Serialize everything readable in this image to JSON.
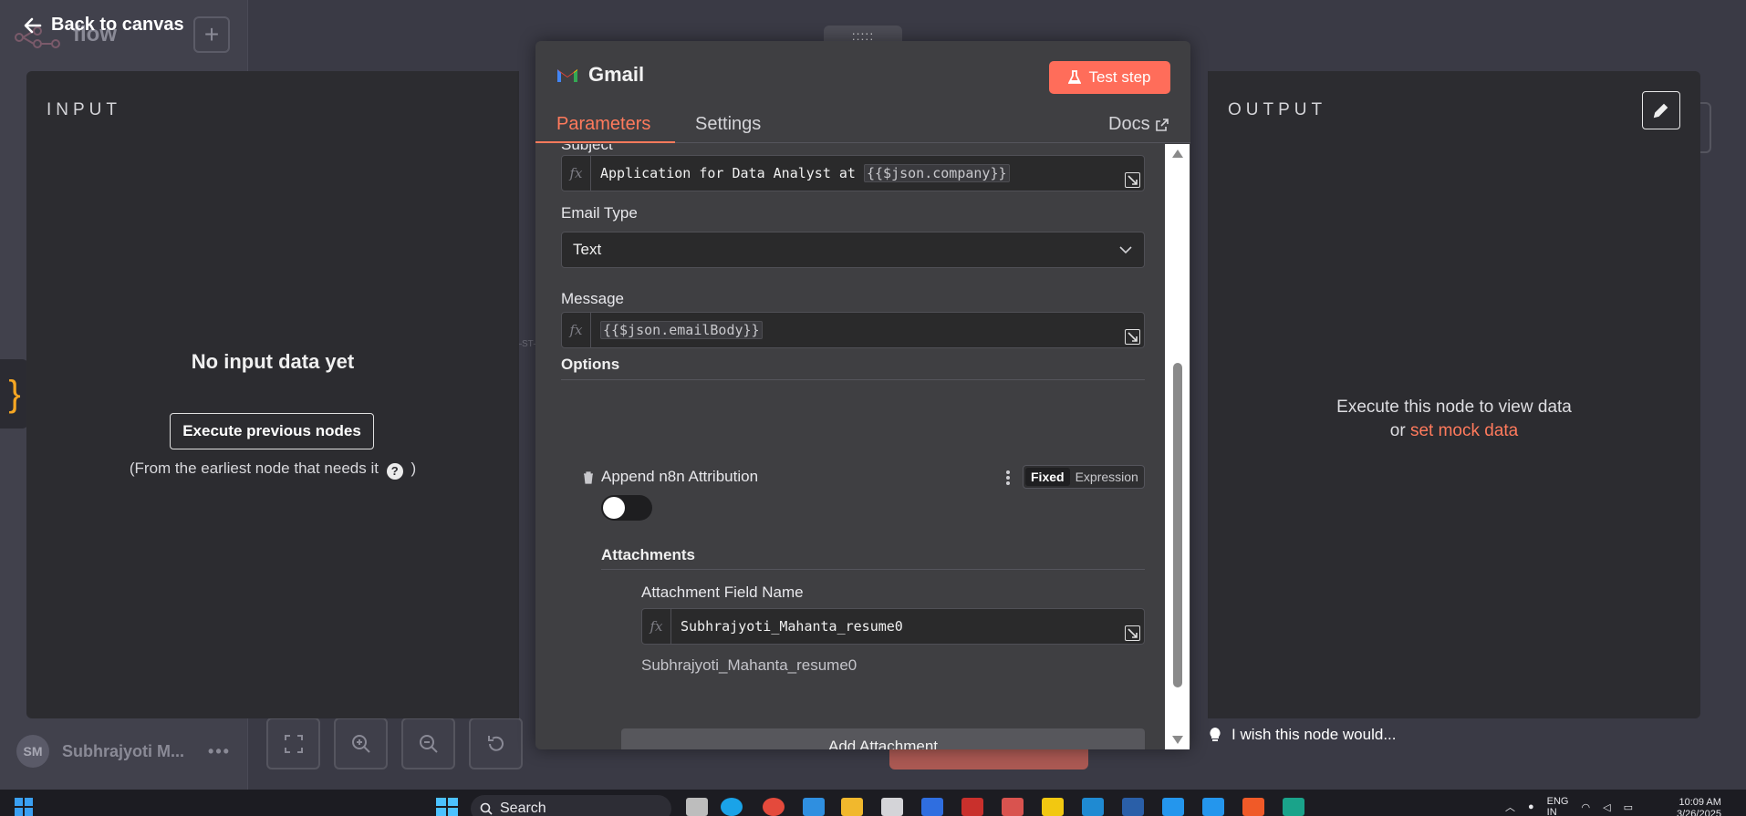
{
  "background": {
    "workflow_title": "flow",
    "back_label": "Back to canvas",
    "user_initials": "SM",
    "user_name": "Subhrajyoti M...",
    "user_menu": "•••"
  },
  "input_panel": {
    "label": "INPUT",
    "empty_title": "No input data yet",
    "execute_button": "Execute previous nodes",
    "hint": "(From the earliest node that needs it",
    "hint_suffix": ")"
  },
  "output_panel": {
    "label": "OUTPUT",
    "message_line1": "Execute this node to view data",
    "message_prefix": "or ",
    "mock_link": "set mock data",
    "wish": "I wish this node would..."
  },
  "modal": {
    "drag_handle": ":::::",
    "title": "Gmail",
    "test_step": "Test step",
    "tabs": [
      "Parameters",
      "Settings"
    ],
    "docs": "Docs",
    "subject_label": "Subject",
    "subject_prefix": "Application for Data Analyst at ",
    "subject_expr": "{{$json.company}}",
    "email_type_label": "Email Type",
    "email_type_value": "Text",
    "message_label": "Message",
    "message_expr": "{{$json.emailBody}}",
    "options_title": "Options",
    "append_label": "Append n8n Attribution",
    "fixed_label": "Fixed",
    "expression_label": "Expression",
    "toggle_on": false,
    "attachments_title": "Attachments",
    "attachment_field_label": "Attachment Field Name",
    "attachment_field_value": "Subhrajyoti_Mahanta_resume0",
    "attachment_preview": "Subhrajyoti_Mahanta_resume0",
    "add_attachment": "Add Attachment"
  },
  "taskbar": {
    "search": "Search",
    "lang": "ENG",
    "lang2": "IN",
    "time": "10:09 AM",
    "date": "3/26/2025"
  },
  "colors": {
    "accent": "#ff6d5a",
    "link": "#ff7a5c",
    "panel": "#2c2c30",
    "modal": "#3f3f42"
  }
}
